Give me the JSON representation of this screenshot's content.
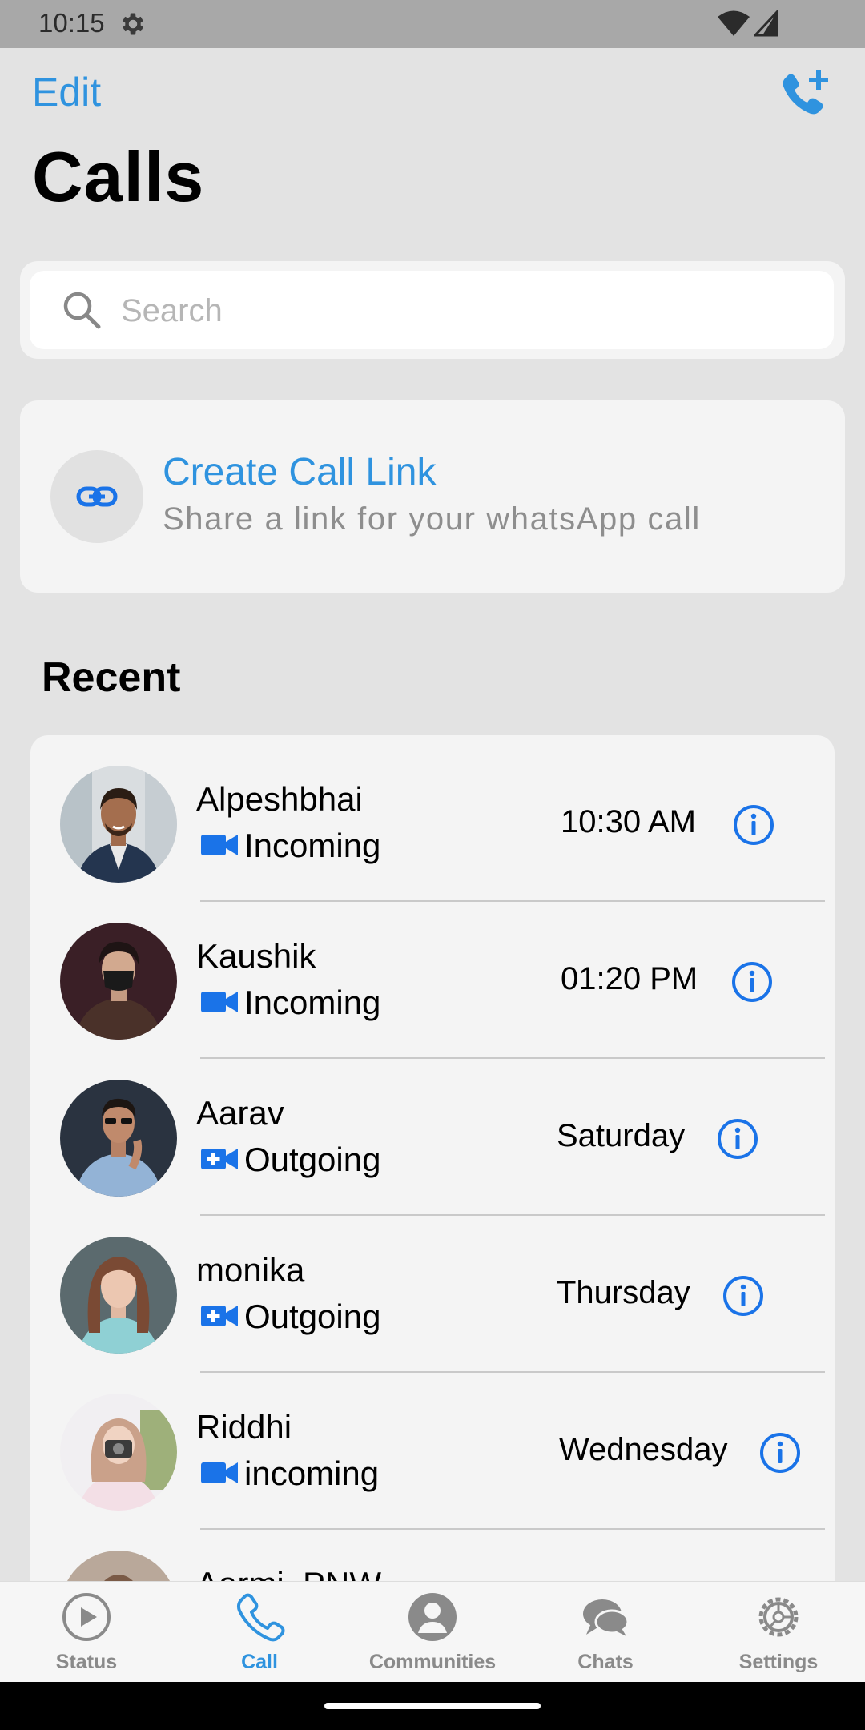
{
  "status_bar": {
    "time": "10:15"
  },
  "header": {
    "edit_label": "Edit",
    "title": "Calls"
  },
  "search": {
    "placeholder": "Search"
  },
  "call_link": {
    "title": "Create Call Link",
    "subtitle": "Share a link for your whatsApp call"
  },
  "recent": {
    "heading": "Recent",
    "calls": [
      {
        "name": "Alpeshbhai",
        "type": "Incoming",
        "when": "10:30 AM",
        "icon": "video-camera-icon"
      },
      {
        "name": "Kaushik",
        "type": "Incoming",
        "when": "01:20 PM",
        "icon": "video-camera-icon"
      },
      {
        "name": "Aarav",
        "type": "Outgoing",
        "when": "Saturday",
        "icon": "video-add-icon"
      },
      {
        "name": "monika",
        "type": "Outgoing",
        "when": "Thursday",
        "icon": "video-add-icon"
      },
      {
        "name": "Riddhi",
        "type": "incoming",
        "when": "Wednesday",
        "icon": "video-camera-icon"
      },
      {
        "name": "Aarmi_PNW",
        "type": "",
        "when": "",
        "icon": ""
      }
    ]
  },
  "tabs": [
    {
      "label": "Status",
      "icon": "play-circle-icon",
      "active": false
    },
    {
      "label": "Call",
      "icon": "phone-icon",
      "active": true
    },
    {
      "label": "Communities",
      "icon": "community-icon",
      "active": false
    },
    {
      "label": "Chats",
      "icon": "chat-bubbles-icon",
      "active": false
    },
    {
      "label": "Settings",
      "icon": "gear-icon",
      "active": false
    }
  ],
  "colors": {
    "accent": "#2f93df",
    "icon_blue": "#1a73e8",
    "background": "#e3e3e3",
    "card": "#f4f4f4"
  }
}
